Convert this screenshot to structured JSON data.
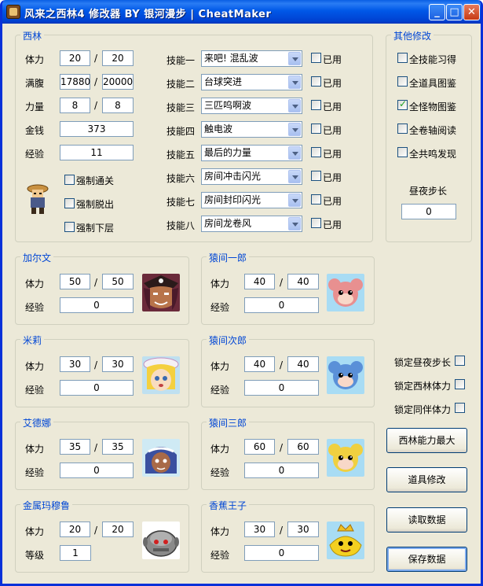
{
  "window": {
    "title": "风来之西林4 修改器 BY 银河漫步 | CheatMaker",
    "min": "_",
    "max": "□",
    "close": "✕"
  },
  "shiren": {
    "title": "西林",
    "hp_label": "体力",
    "hp": "20",
    "hp_max": "20",
    "fullness_label": "满腹",
    "fullness": "17880",
    "fullness_max": "20000",
    "power_label": "力量",
    "power": "8",
    "power_max": "8",
    "money_label": "金钱",
    "money": "373",
    "exp_label": "经验",
    "exp": "11",
    "slash": "/",
    "force_clear": "强制通关",
    "force_escape": "强制脱出",
    "force_down": "强制下层",
    "skills": [
      {
        "label": "技能一",
        "value": "来吧! 混乱波",
        "used": "已用"
      },
      {
        "label": "技能二",
        "value": "台球突进",
        "used": "已用"
      },
      {
        "label": "技能三",
        "value": "三匹呜啊波",
        "used": "已用"
      },
      {
        "label": "技能四",
        "value": "触电波",
        "used": "已用"
      },
      {
        "label": "技能五",
        "value": "最后的力量",
        "used": "已用"
      },
      {
        "label": "技能六",
        "value": "房间冲击闪光",
        "used": "已用"
      },
      {
        "label": "技能七",
        "value": "房间封印闪光",
        "used": "已用"
      },
      {
        "label": "技能八",
        "value": "房间龙卷风",
        "used": "已用"
      }
    ]
  },
  "other": {
    "title": "其他修改",
    "all_skills": "全技能习得",
    "all_items": "全道具图鉴",
    "all_monsters": "全怪物图鉴",
    "all_scrolls": "全卷轴阅读",
    "all_resonance": "全共鸣发现",
    "daynight_label": "昼夜步长",
    "daynight": "0"
  },
  "companions": [
    {
      "name": "加尔文",
      "hp_label": "体力",
      "hp": "50",
      "hp_max": "50",
      "exp_label": "经验",
      "exp": "0"
    },
    {
      "name": "米莉",
      "hp_label": "体力",
      "hp": "30",
      "hp_max": "30",
      "exp_label": "经验",
      "exp": "0"
    },
    {
      "name": "艾德娜",
      "hp_label": "体力",
      "hp": "35",
      "hp_max": "35",
      "exp_label": "经验",
      "exp": "0"
    },
    {
      "name": "金属玛穆鲁",
      "hp_label": "体力",
      "hp": "20",
      "hp_max": "20",
      "exp_label": "等级",
      "exp": "1"
    },
    {
      "name": "猿间一郎",
      "hp_label": "体力",
      "hp": "40",
      "hp_max": "40",
      "exp_label": "经验",
      "exp": "0"
    },
    {
      "name": "猿间次郎",
      "hp_label": "体力",
      "hp": "40",
      "hp_max": "40",
      "exp_label": "经验",
      "exp": "0"
    },
    {
      "name": "猿间三郎",
      "hp_label": "体力",
      "hp": "60",
      "hp_max": "60",
      "exp_label": "经验",
      "exp": "0"
    },
    {
      "name": "香蕉王子",
      "hp_label": "体力",
      "hp": "30",
      "hp_max": "30",
      "exp_label": "经验",
      "exp": "0"
    }
  ],
  "locks": {
    "daynight": "锁定昼夜步长",
    "shiren_hp": "锁定西林体力",
    "ally_hp": "锁定同伴体力"
  },
  "buttons": {
    "max_ability": "西林能力最大",
    "item_edit": "道具修改",
    "read_data": "读取数据",
    "save_data": "保存数据"
  },
  "checked": {
    "all_monsters": true
  }
}
